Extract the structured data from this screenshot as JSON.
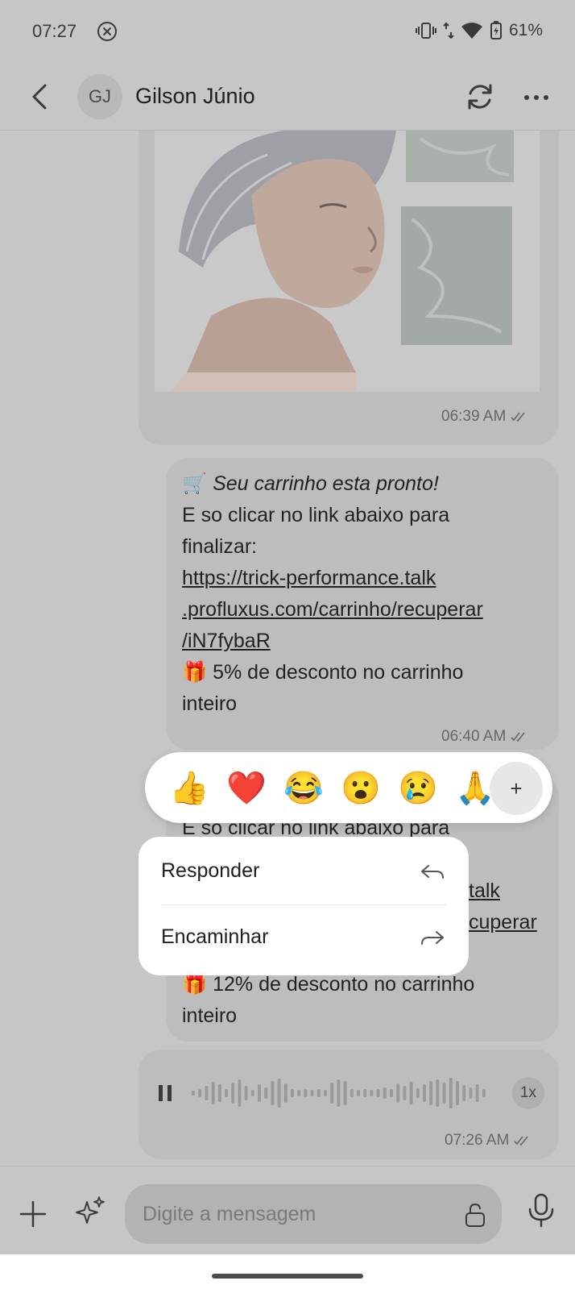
{
  "status_bar": {
    "time": "07:27",
    "battery": "61%"
  },
  "header": {
    "avatar_initials": "GJ",
    "contact_name": "Gilson Júnio"
  },
  "messages": [
    {
      "type": "image",
      "time": "06:39 AM"
    },
    {
      "type": "text",
      "line1": "Seu carrinho esta pronto!",
      "line2": "E so clicar no link abaixo para",
      "line3": "finalizar:",
      "link1": "https://trick-performance.talk",
      "link2": ".profluxus.com/carrinho/recuperar",
      "link3": "/iN7fybaR",
      "line4": "5% de desconto no carrinho",
      "line5": "inteiro",
      "time": "06:40 AM"
    },
    {
      "type": "text",
      "partial_line1": "E so clicar no link abaixo para",
      "partial_link1": "talk",
      "partial_link2": "cuperar",
      "line4": "12% de desconto no carrinho",
      "line5": "inteiro"
    },
    {
      "type": "audio",
      "speed": "1x",
      "time": "07:26 AM"
    }
  ],
  "reactions": [
    "👍",
    "❤️",
    "😂",
    "😮",
    "😢",
    "🙏"
  ],
  "reaction_more": "+",
  "context_menu": {
    "reply": "Responder",
    "forward": "Encaminhar"
  },
  "composer": {
    "placeholder": "Digite a mensagem"
  },
  "icons": {
    "cart": "🛒",
    "gift": "🎁"
  }
}
